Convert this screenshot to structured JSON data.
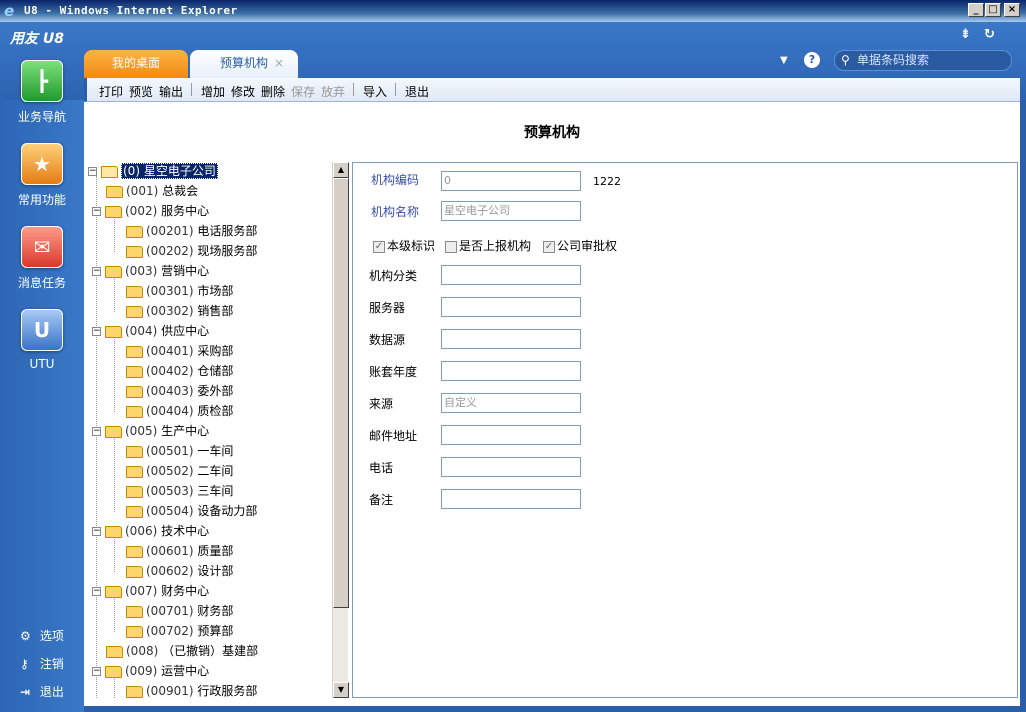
{
  "window": {
    "title": "U8 - Windows Internet Explorer",
    "icon_name": "ie-icon",
    "buttons": {
      "minimize": "_",
      "maximize": "□",
      "close": "×"
    }
  },
  "app": {
    "brand": "用友 U8",
    "top_icons": {
      "collapse": "⇟",
      "refresh": "↻"
    }
  },
  "tabs": [
    {
      "label": "我的桌面",
      "active": false
    },
    {
      "label": "预算机构",
      "active": true,
      "close": "×"
    }
  ],
  "header": {
    "dropdown": "▼",
    "help": "?",
    "search_placeholder": "单据条码搜索"
  },
  "sidebar": {
    "items": [
      {
        "label": "业务导航",
        "icon": "flowchart-icon"
      },
      {
        "label": "常用功能",
        "icon": "star-icon"
      },
      {
        "label": "消息任务",
        "icon": "mail-icon"
      },
      {
        "label": "UTU",
        "icon": "utu-icon"
      }
    ],
    "bottom": [
      {
        "label": "选项",
        "icon": "gear-icon"
      },
      {
        "label": "注销",
        "icon": "key-icon"
      },
      {
        "label": "退出",
        "icon": "exit-icon"
      }
    ]
  },
  "toolbar": {
    "print": "打印",
    "preview": "预览",
    "export": "输出",
    "add": "增加",
    "edit": "修改",
    "delete": "删除",
    "save": "保存",
    "discard": "放弃",
    "import": "导入",
    "quit": "退出"
  },
  "page": {
    "title": "预算机构"
  },
  "tree": {
    "root": {
      "code": "(0)",
      "name": "星空电子公司"
    },
    "nodes": [
      {
        "code": "(001)",
        "name": "总裁会"
      },
      {
        "code": "(002)",
        "name": "服务中心"
      },
      {
        "code": "(00201)",
        "name": "电话服务部"
      },
      {
        "code": "(00202)",
        "name": "现场服务部"
      },
      {
        "code": "(003)",
        "name": "营销中心"
      },
      {
        "code": "(00301)",
        "name": "市场部"
      },
      {
        "code": "(00302)",
        "name": "销售部"
      },
      {
        "code": "(004)",
        "name": "供应中心"
      },
      {
        "code": "(00401)",
        "name": "采购部"
      },
      {
        "code": "(00402)",
        "name": "仓储部"
      },
      {
        "code": "(00403)",
        "name": "委外部"
      },
      {
        "code": "(00404)",
        "name": "质检部"
      },
      {
        "code": "(005)",
        "name": "生产中心"
      },
      {
        "code": "(00501)",
        "name": "一车间"
      },
      {
        "code": "(00502)",
        "name": "二车间"
      },
      {
        "code": "(00503)",
        "name": "三车间"
      },
      {
        "code": "(00504)",
        "name": "设备动力部"
      },
      {
        "code": "(006)",
        "name": "技术中心"
      },
      {
        "code": "(00601)",
        "name": "质量部"
      },
      {
        "code": "(00602)",
        "name": "设计部"
      },
      {
        "code": "(007)",
        "name": "财务中心"
      },
      {
        "code": "(00701)",
        "name": "财务部"
      },
      {
        "code": "(00702)",
        "name": "预算部"
      },
      {
        "code": "(008)",
        "name": "（已撤销）基建部"
      },
      {
        "code": "(009)",
        "name": "运营中心"
      },
      {
        "code": "(00901)",
        "name": "行政服务部"
      }
    ]
  },
  "form": {
    "org_code_label": "机构编码",
    "org_code_value": "0",
    "org_code_side": "1222",
    "org_name_label": "机构名称",
    "org_name_value": "星空电子公司",
    "cb_local": "本级标识",
    "cb_report": "是否上报机构",
    "cb_approve": "公司审批权",
    "category_label": "机构分类",
    "server_label": "服务器",
    "datasource_label": "数据源",
    "year_label": "账套年度",
    "source_label": "来源",
    "source_value": "自定义",
    "email_label": "邮件地址",
    "phone_label": "电话",
    "remark_label": "备注"
  }
}
